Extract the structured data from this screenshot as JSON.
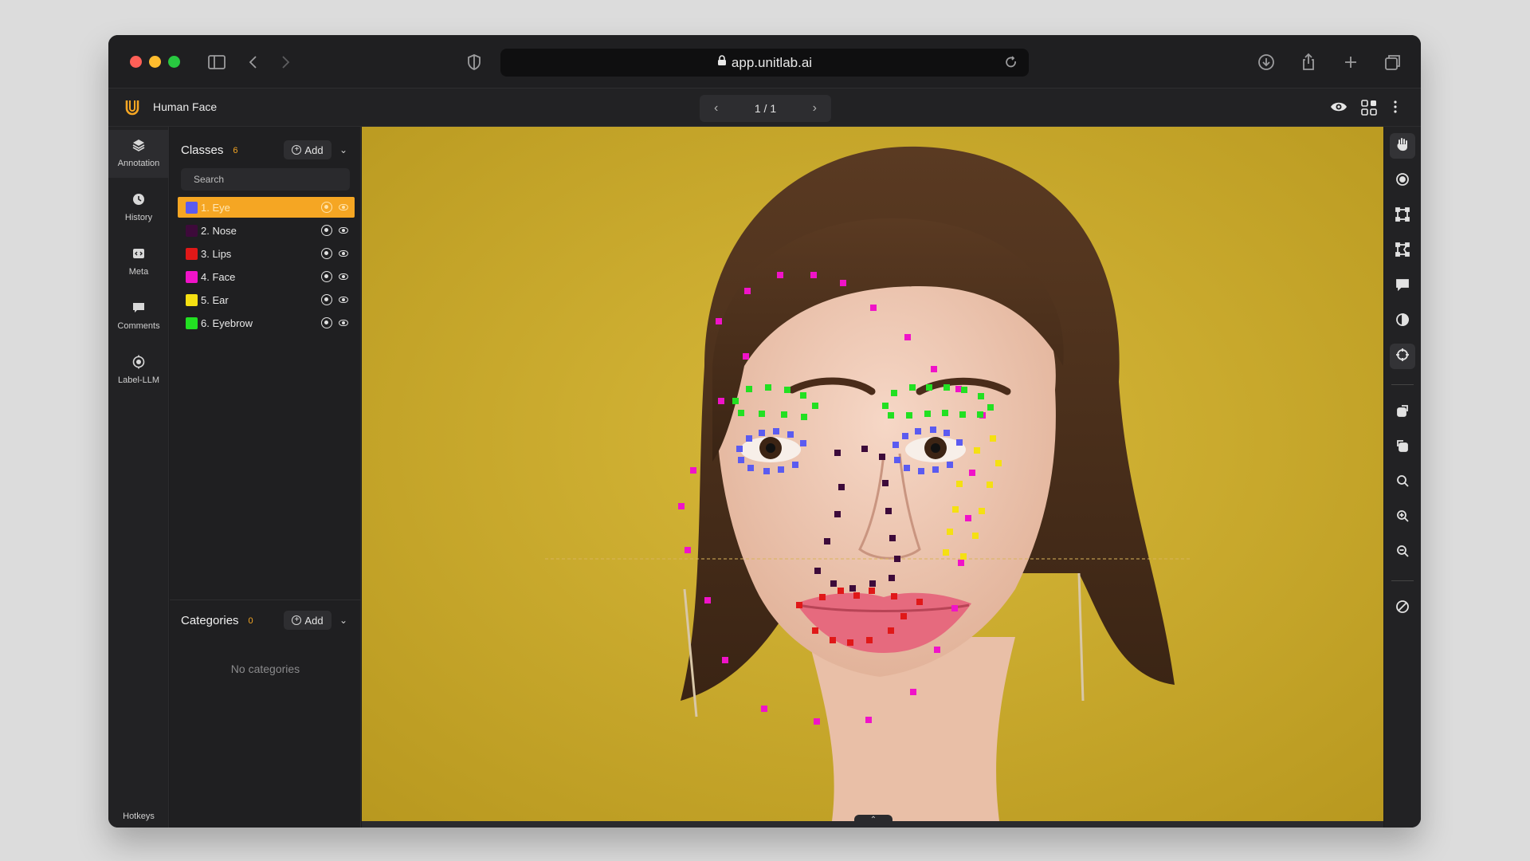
{
  "browser": {
    "url": "app.unitlab.ai"
  },
  "header": {
    "project_title": "Human Face",
    "page_indicator": "1 / 1"
  },
  "rail": {
    "items": [
      {
        "label": "Annotation",
        "icon": "layers-icon"
      },
      {
        "label": "History",
        "icon": "clock-icon"
      },
      {
        "label": "Meta",
        "icon": "code-icon"
      },
      {
        "label": "Comments",
        "icon": "comment-icon"
      },
      {
        "label": "Label-LLM",
        "icon": "robot-icon"
      }
    ],
    "hotkeys_label": "Hotkeys"
  },
  "classes": {
    "title": "Classes",
    "count": "6",
    "add_label": "Add",
    "search_placeholder": "Search",
    "items": [
      {
        "label": "1. Eye",
        "color": "#5b5bf0"
      },
      {
        "label": "2. Nose",
        "color": "#3d0a3a"
      },
      {
        "label": "3. Lips",
        "color": "#e01818"
      },
      {
        "label": "4. Face",
        "color": "#f013c8"
      },
      {
        "label": "5. Ear",
        "color": "#f5e012"
      },
      {
        "label": "6. Eyebrow",
        "color": "#22e022"
      }
    ]
  },
  "categories": {
    "title": "Categories",
    "count": "0",
    "add_label": "Add",
    "empty_text": "No categories"
  },
  "colors": {
    "accent": "#f5a623",
    "eye": "#5b5bf0",
    "nose": "#3d0a3a",
    "lips": "#e01818",
    "face": "#f013c8",
    "ear": "#f5e012",
    "eyebrow": "#22e022"
  }
}
